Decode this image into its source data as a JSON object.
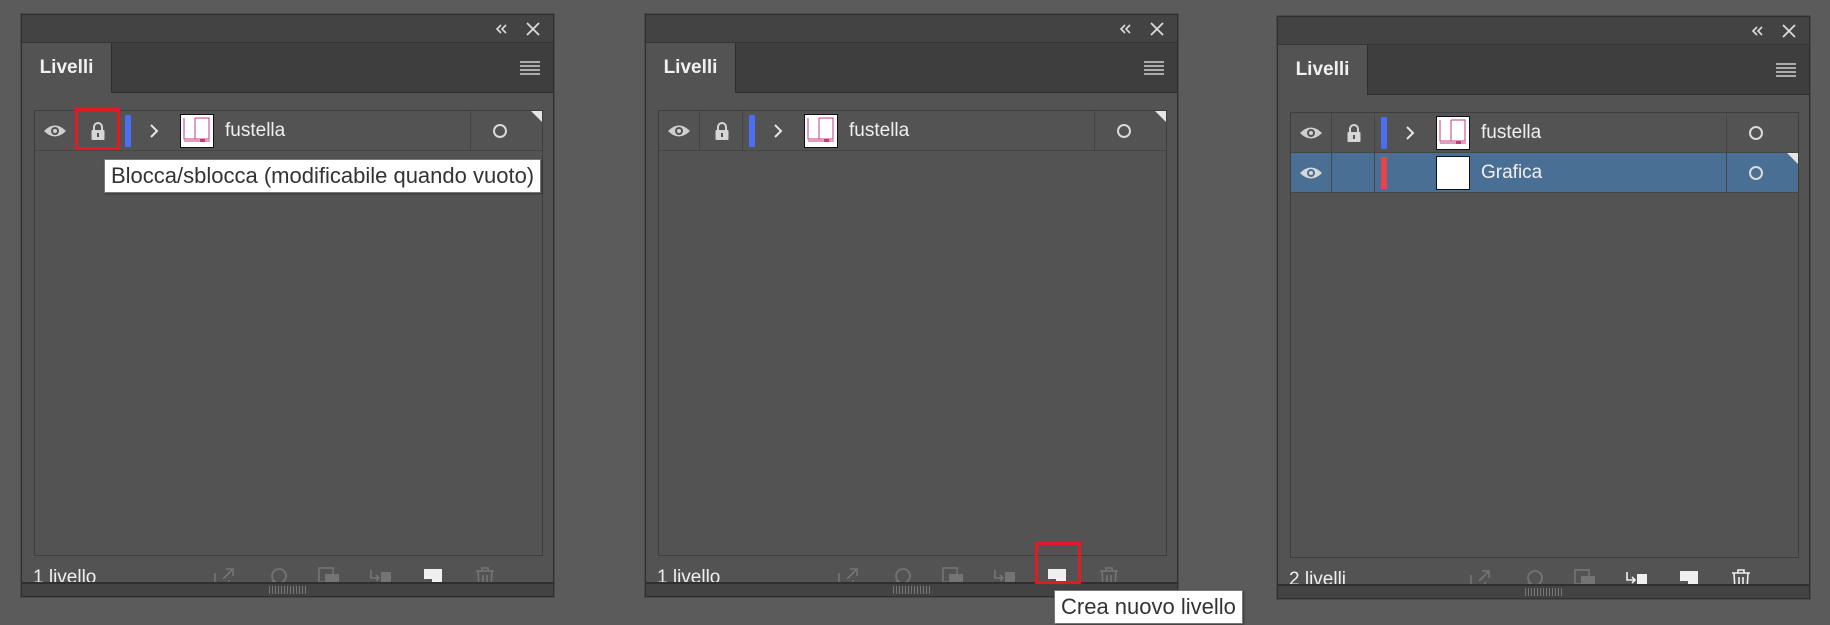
{
  "colors": {
    "background": "#5b5b5b",
    "panel": "#535353",
    "titlebar": "#434343",
    "selected_row": "#4a6f95",
    "layer_blue": "#4b6ff0",
    "layer_red": "#e8444c",
    "highlight_red": "#e01b24"
  },
  "panels": [
    {
      "tab_label": "Livelli",
      "layers": [
        {
          "name": "fustella",
          "color": "#4b6ff0",
          "visible": true,
          "locked": true,
          "expandable": true,
          "thumbnail": "artwork",
          "selected": false
        }
      ],
      "layer_count": "1 livello",
      "tooltip": "Blocca/sblocca (modificabile quando vuoto)"
    },
    {
      "tab_label": "Livelli",
      "layers": [
        {
          "name": "fustella",
          "color": "#4b6ff0",
          "visible": true,
          "locked": true,
          "expandable": true,
          "thumbnail": "artwork",
          "selected": false
        }
      ],
      "layer_count": "1 livello",
      "tooltip": "Crea nuovo livello"
    },
    {
      "tab_label": "Livelli",
      "layers": [
        {
          "name": "fustella",
          "color": "#4b6ff0",
          "visible": true,
          "locked": true,
          "expandable": true,
          "thumbnail": "artwork",
          "selected": false
        },
        {
          "name": "Grafica",
          "color": "#e8444c",
          "visible": true,
          "locked": false,
          "expandable": false,
          "thumbnail": "blank",
          "selected": true
        }
      ],
      "layer_count": "2 livelli",
      "tooltip": ""
    }
  ],
  "icons": {
    "titlebar": [
      "collapse-icon",
      "close-icon"
    ],
    "tab": "panel-menu-icon",
    "footer": [
      "collect-for-export-icon",
      "locate-object-icon",
      "clipping-mask-icon",
      "create-sublayer-icon",
      "create-new-layer-icon",
      "delete-layer-icon"
    ]
  }
}
